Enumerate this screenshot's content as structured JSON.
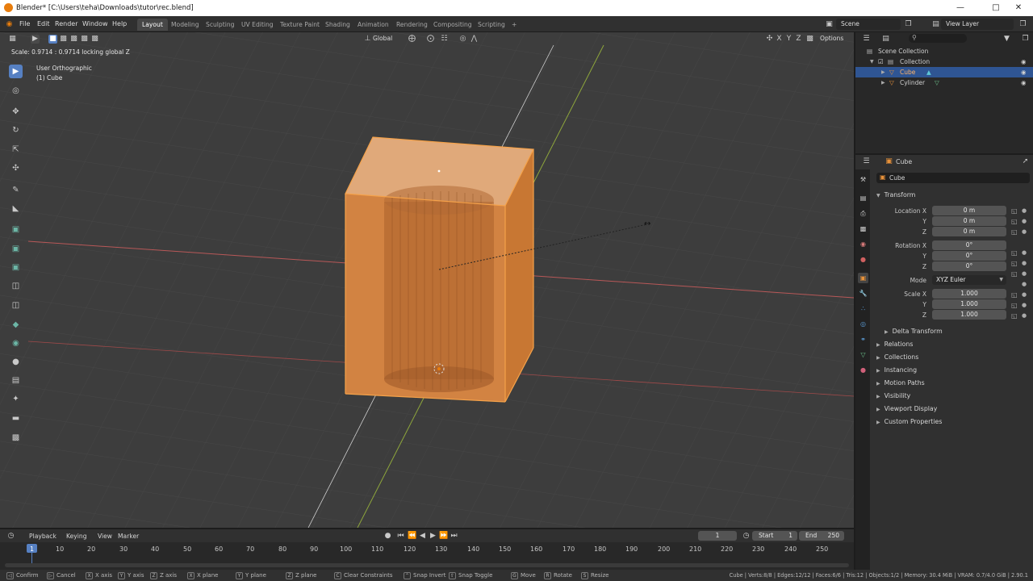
{
  "window": {
    "title": "Blender* [C:\\Users\\teha\\Downloads\\tutor\\rec.blend]"
  },
  "menu": [
    "File",
    "Edit",
    "Render",
    "Window",
    "Help"
  ],
  "workspaces": [
    "Layout",
    "Modeling",
    "Sculpting",
    "UV Editing",
    "Texture Paint",
    "Shading",
    "Animation",
    "Rendering",
    "Compositing",
    "Scripting"
  ],
  "active_workspace": "Layout",
  "scene": {
    "scene_name": "Scene",
    "view_layer": "View Layer"
  },
  "viewport": {
    "operator_info": "Scale: 0.9714 : 0.9714 locking global Z",
    "view_name": "User Orthographic",
    "active_object": "(1) Cube",
    "orientation": "Global",
    "options_label": "Options"
  },
  "outliner": {
    "root": "Scene Collection",
    "collection": "Collection",
    "items": [
      {
        "name": "Cube",
        "selected": true
      },
      {
        "name": "Cylinder",
        "selected": false
      }
    ]
  },
  "properties": {
    "context_object": "Cube",
    "object_name": "Cube",
    "transform_title": "Transform",
    "location_label": "Location X",
    "location": [
      "0 m",
      "0 m",
      "0 m"
    ],
    "rotation_label": "Rotation X",
    "rotation": [
      "0°",
      "0°",
      "0°"
    ],
    "mode_label": "Mode",
    "mode_value": "XYZ Euler",
    "scale_label": "Scale X",
    "scale": [
      "1.000",
      "1.000",
      "1.000"
    ],
    "axis_y": "Y",
    "axis_z": "Z",
    "delta_transform": "Delta Transform",
    "panels": [
      "Relations",
      "Collections",
      "Instancing",
      "Motion Paths",
      "Visibility",
      "Viewport Display",
      "Custom Properties"
    ]
  },
  "timeline": {
    "menus": [
      "Playback",
      "Keying",
      "View",
      "Marker"
    ],
    "current_frame": "1",
    "start_label": "Start",
    "start": "1",
    "end_label": "End",
    "end": "250",
    "ruler": [
      "1",
      "10",
      "20",
      "30",
      "40",
      "50",
      "60",
      "70",
      "80",
      "90",
      "100",
      "110",
      "120",
      "130",
      "140",
      "150",
      "160",
      "170",
      "180",
      "190",
      "200",
      "210",
      "220",
      "230",
      "240",
      "250"
    ]
  },
  "statusbar": {
    "hints": [
      "Confirm",
      "Cancel",
      "X axis",
      "Y axis",
      "Z axis",
      "X plane",
      "Y plane",
      "Z plane",
      "Clear Constraints",
      "Snap Invert",
      "Snap Toggle",
      "Move",
      "Rotate",
      "Resize"
    ],
    "keys": [
      "X",
      "Y",
      "Z",
      "X",
      "Y",
      "Z",
      "C",
      "G",
      "R",
      "S"
    ],
    "stats": "Cube | Verts:8/8 | Edges:12/12 | Faces:6/6 | Tris:12 | Objects:1/2 | Memory: 30.4 MiB | VRAM: 0.7/4.0 GiB | 2.90.1"
  },
  "colors": {
    "accent": "#5680c2",
    "selection_orange": "#e8923a",
    "x_axis": "#d05a5a",
    "y_axis": "#8fb040"
  }
}
